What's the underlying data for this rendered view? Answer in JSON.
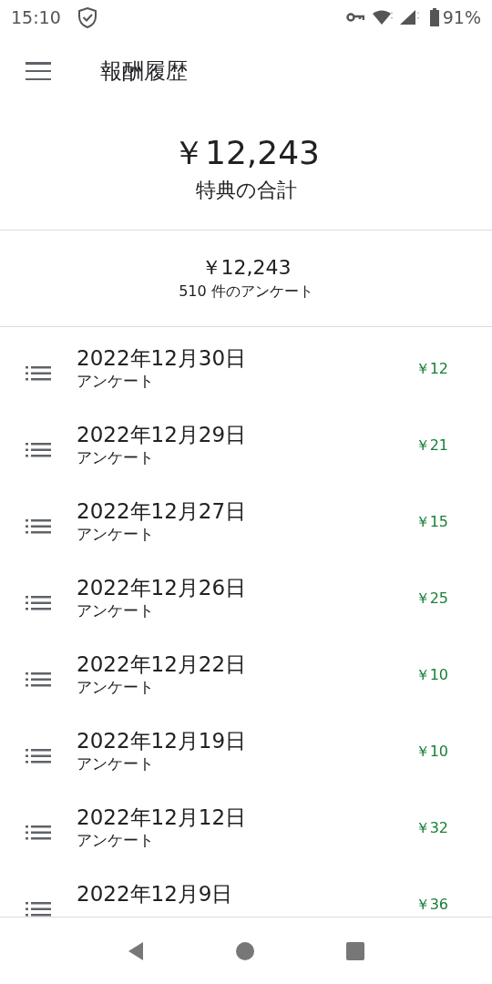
{
  "status_bar": {
    "time": "15:10",
    "battery": "91%"
  },
  "app_bar": {
    "title": "報酬履歴"
  },
  "total": {
    "amount": "￥12,243",
    "label": "特典の合計"
  },
  "summary": {
    "amount": "￥12,243",
    "count": "510 件のアンケート"
  },
  "rewards": [
    {
      "date": "2022年12月30日",
      "type": "アンケート",
      "amount": "￥12"
    },
    {
      "date": "2022年12月29日",
      "type": "アンケート",
      "amount": "￥21"
    },
    {
      "date": "2022年12月27日",
      "type": "アンケート",
      "amount": "￥15"
    },
    {
      "date": "2022年12月26日",
      "type": "アンケート",
      "amount": "￥25"
    },
    {
      "date": "2022年12月22日",
      "type": "アンケート",
      "amount": "￥10"
    },
    {
      "date": "2022年12月19日",
      "type": "アンケート",
      "amount": "￥10"
    },
    {
      "date": "2022年12月12日",
      "type": "アンケート",
      "amount": "￥32"
    },
    {
      "date": "2022年12月9日",
      "amount": "￥36"
    }
  ]
}
